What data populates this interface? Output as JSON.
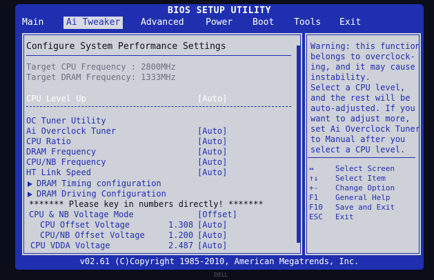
{
  "title": "BIOS SETUP UTILITY",
  "menu": [
    "Main",
    "Ai Tweaker",
    "Advanced",
    "Power",
    "Boot",
    "Tools",
    "Exit"
  ],
  "active_menu": "Ai Tweaker",
  "section_title": "Configure System Performance Settings",
  "info": [
    {
      "label": "Target CPU Frequency : 2800MHz"
    },
    {
      "label": "Target DRAM Frequency: 1333MHz"
    }
  ],
  "selected": {
    "label": "CPU Level Up",
    "value": "[Auto]"
  },
  "settings": [
    {
      "label": "OC Tuner Utility",
      "value": ""
    },
    {
      "label": "Ai Overclock Tuner",
      "value": "[Auto]"
    },
    {
      "label": "CPU Ratio",
      "value": "[Auto]"
    },
    {
      "label": "DRAM Frequency",
      "value": "[Auto]"
    },
    {
      "label": "CPU/NB Frequency",
      "value": "[Auto]"
    },
    {
      "label": "HT Link Speed",
      "value": "[Auto]"
    }
  ],
  "submenus": [
    "DRAM Timing configuration",
    "DRAM Driving Configuration"
  ],
  "notice": "******* Please key in numbers directly! *******",
  "voltage": [
    {
      "label": "CPU & NB Voltage Mode",
      "current": "",
      "value": "[Offset]"
    },
    {
      "label": "CPU Offset Voltage",
      "current": "1.308",
      "value": "[Auto]"
    },
    {
      "label": "CPU/NB Offset Voltage",
      "current": "1.200",
      "value": "[Auto]"
    },
    {
      "label": "CPU VDDA Voltage",
      "current": "2.487",
      "value": "[Auto]"
    }
  ],
  "help": [
    "Warning: this function",
    "belongs to overclock-",
    "ing, and it may cause",
    "instability.",
    "Select a CPU level,",
    "and the rest will be",
    "auto-adjusted. If you",
    "want to adjust more,",
    "set Ai Overclock Tuner",
    "to Manual after you",
    "select a CPU level."
  ],
  "keys": [
    {
      "key": "↔",
      "desc": "Select Screen"
    },
    {
      "key": "↑↓",
      "desc": "Select Item"
    },
    {
      "key": "+-",
      "desc": "Change Option"
    },
    {
      "key": "F1",
      "desc": "General Help"
    },
    {
      "key": "F10",
      "desc": "Save and Exit"
    },
    {
      "key": "ESC",
      "desc": "Exit"
    }
  ],
  "footer": "v02.61 (C)Copyright 1985-2010, American Megatrends, Inc.",
  "bezel_brand": "DELL",
  "colors": {
    "bios_blue": "#1f2fb0",
    "panel_grey": "#cfd1d9",
    "highlight": "#ffffff"
  }
}
